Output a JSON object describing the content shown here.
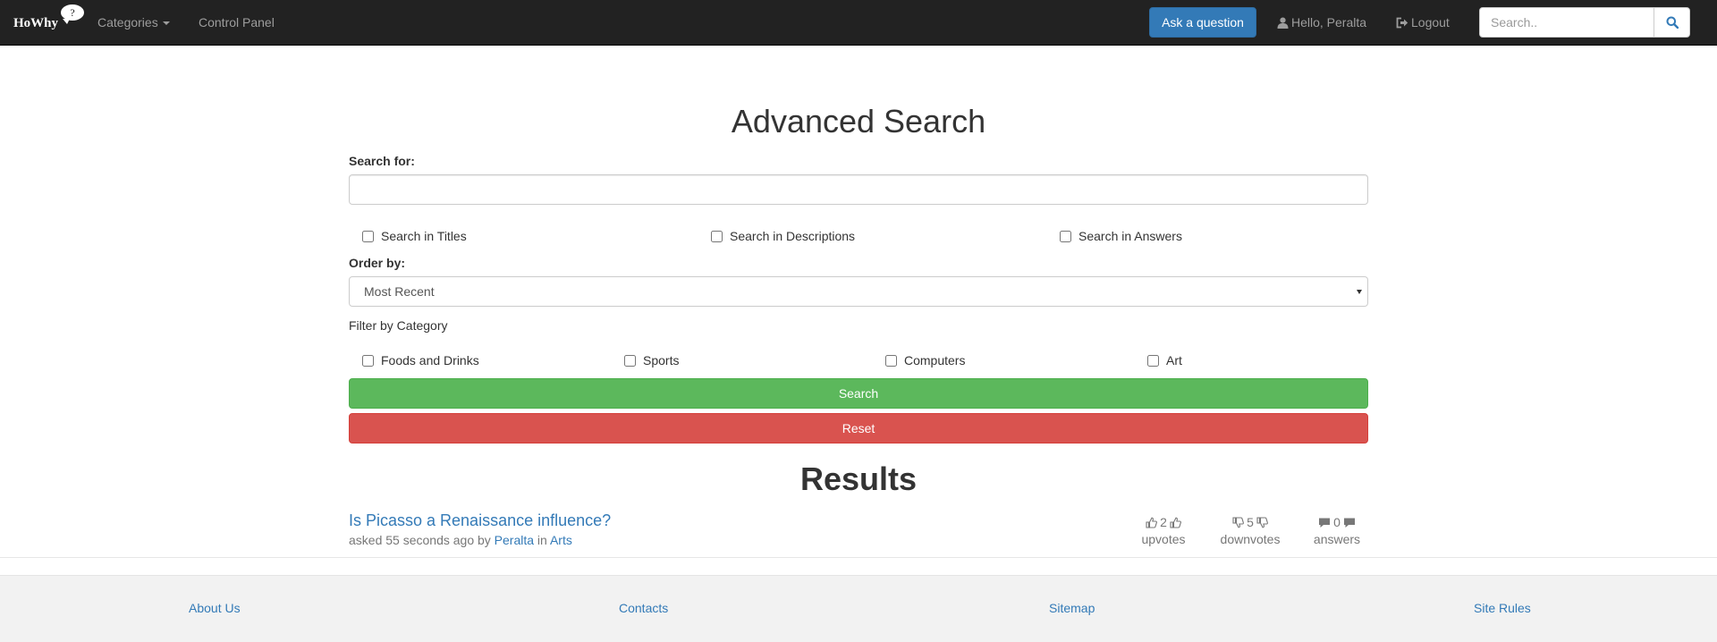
{
  "navbar": {
    "brand": "HoWhy",
    "brand_mark": "?",
    "categories_label": "Categories",
    "control_panel_label": "Control Panel",
    "ask_label": "Ask a question",
    "greeting": "Hello, Peralta",
    "logout_label": "Logout",
    "search_placeholder": "Search..",
    "brand_color": "#337ab7"
  },
  "form": {
    "title": "Advanced Search",
    "search_for_label": "Search for:",
    "search_for_value": "",
    "scope_options": [
      {
        "label": "Search in Titles",
        "checked": false
      },
      {
        "label": "Search in Descriptions",
        "checked": false
      },
      {
        "label": "Search in Answers",
        "checked": false
      }
    ],
    "order_by_label": "Order by:",
    "order_by_value": "Most Recent",
    "filter_label": "Filter by Category",
    "categories": [
      {
        "label": "Foods and Drinks",
        "checked": false
      },
      {
        "label": "Sports",
        "checked": false
      },
      {
        "label": "Computers",
        "checked": false
      },
      {
        "label": "Art",
        "checked": false
      }
    ],
    "search_button": "Search",
    "reset_button": "Reset",
    "search_color": "#5cb85c",
    "reset_color": "#d9534f"
  },
  "results": {
    "title": "Results",
    "items": [
      {
        "title": "Is Picasso a Renaissance influence?",
        "asked": "asked 55 seconds ago by",
        "author": "Peralta",
        "in": "in",
        "category": "Arts",
        "upvotes": "2",
        "upvotes_label": "upvotes",
        "downvotes": "5",
        "downvotes_label": "downvotes",
        "answers": "0",
        "answers_label": "answers"
      }
    ]
  },
  "footer": {
    "links": [
      "About Us",
      "Contacts",
      "Sitemap",
      "Site Rules"
    ]
  }
}
